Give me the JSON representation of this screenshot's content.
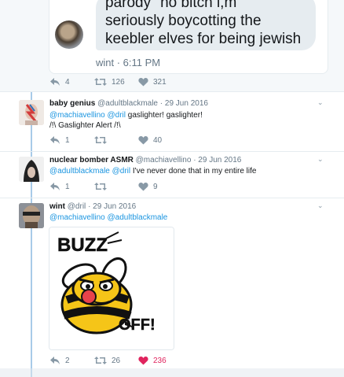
{
  "top": {
    "bubble_lines": [
      "parody \"no bitch i,m",
      "seriously boycotting the",
      "keebler elves for being jewish"
    ],
    "dm_meta": "wint · 6:11 PM",
    "reply_count": "4",
    "retweet_count": "126",
    "like_count": "321"
  },
  "tweets": [
    {
      "name": "baby genius",
      "handle": "@adultblackmale",
      "date": "· 29 Jun 2016",
      "line1_mention": "@machiavellino @dril",
      "line1_rest": " gaslighter! gaslighter!",
      "line2": "/!\\ Gaslighter Alert /!\\",
      "reply_count": "1",
      "retweet_count": "",
      "like_count": "40"
    },
    {
      "name": "nuclear bomber ASMR",
      "handle": "@machiavellino",
      "date": "· 29 Jun 2016",
      "line1_mention": "@adultblackmale @dril",
      "line1_rest": " I've never done that in my entire life",
      "reply_count": "1",
      "retweet_count": "",
      "like_count": "9"
    },
    {
      "name": "wint",
      "handle": "@dril",
      "date": "· 29 Jun 2016",
      "line1_mention": "@machiavellino @adultblackmale",
      "line1_rest": "",
      "image_top_text": "BUZZ",
      "image_bottom_text": "OFF!",
      "reply_count": "2",
      "retweet_count": "26",
      "like_count": "236"
    }
  ],
  "colors": {
    "link": "#1b95e0",
    "muted": "#657786",
    "liked": "#e0245e",
    "thread_line": "#a8cbe8"
  }
}
